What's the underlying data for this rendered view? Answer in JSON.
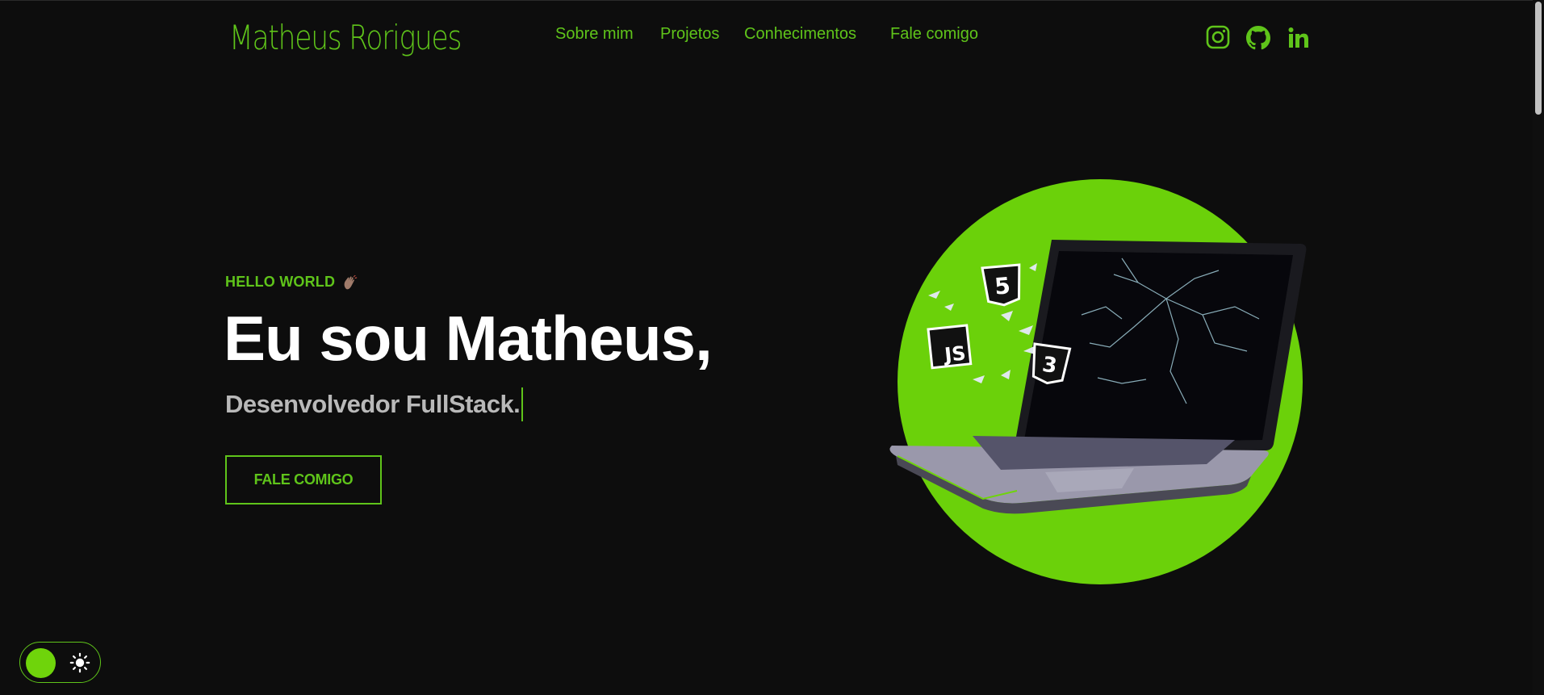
{
  "header": {
    "logo": "Matheus Rorigues",
    "nav": [
      {
        "label": "Sobre mim"
      },
      {
        "label": "Projetos"
      },
      {
        "label": "Conhecimentos"
      },
      {
        "label": "Fale comigo"
      }
    ],
    "social_icons": [
      "instagram-icon",
      "github-icon",
      "linkedin-icon"
    ]
  },
  "hero": {
    "eyebrow": "HELLO WORLD",
    "eyebrow_icon": "waving-hand-icon",
    "headline": "Eu sou Matheus,",
    "subline": "Desenvolvedor FullStack.",
    "cta_label": "FALE COMIGO",
    "badges": [
      "5",
      "JS",
      "3"
    ]
  },
  "theme_toggle": {
    "icon": "sun-icon",
    "state": "dark"
  },
  "colors": {
    "background": "#0d0d0d",
    "accent": "#5fc41a",
    "accent_bright": "#6fd40b",
    "headline": "#ffffff",
    "subline": "#b9b9b9"
  }
}
